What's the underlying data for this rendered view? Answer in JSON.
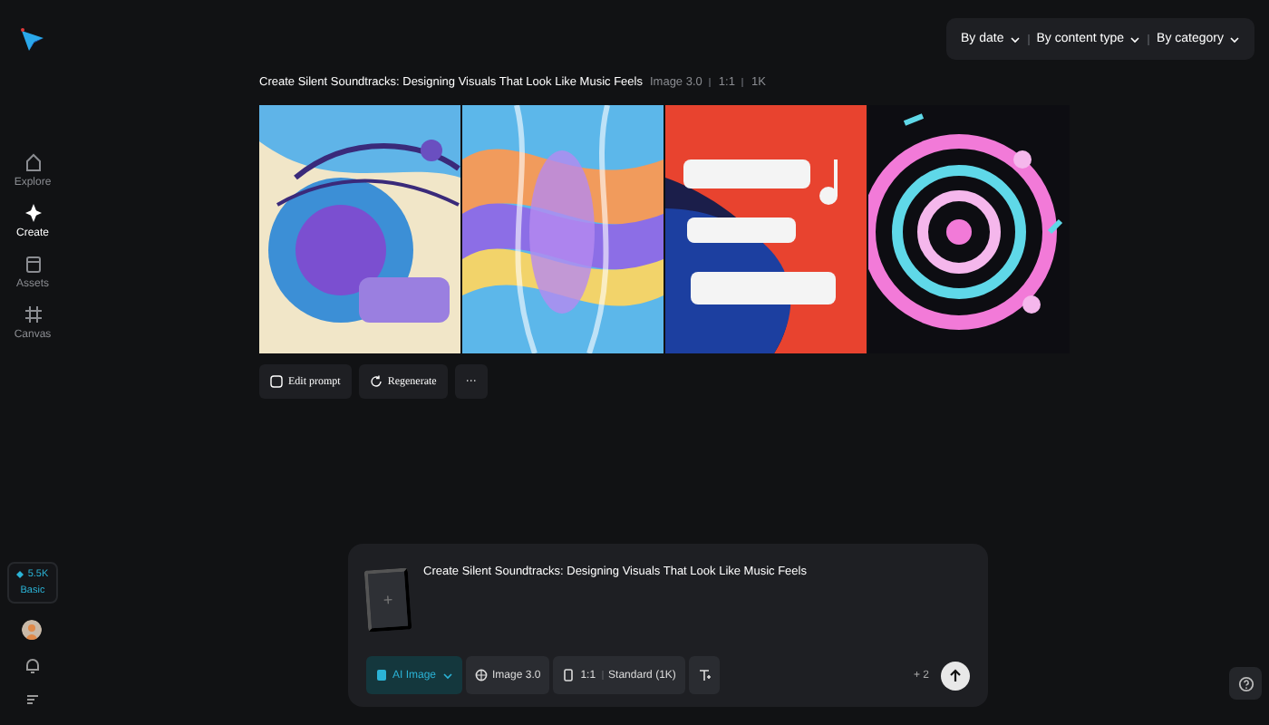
{
  "sidebar": {
    "nav": [
      {
        "label": "Explore",
        "selected": false
      },
      {
        "label": "Create",
        "selected": true
      },
      {
        "label": "Assets",
        "selected": false
      },
      {
        "label": "Canvas",
        "selected": false
      }
    ],
    "credits": {
      "amount": "5.5K",
      "plan": "Basic"
    }
  },
  "filters": [
    "By date",
    "By content type",
    "By category"
  ],
  "generation": {
    "title": "Create Silent Soundtracks: Designing Visuals That Look Like Music Feels",
    "meta": [
      "Image 3.0",
      "1:1",
      "1K"
    ],
    "images": [
      {
        "kind": "picture"
      },
      {
        "kind": "picture"
      },
      {
        "kind": "picture"
      },
      {
        "kind": "picture"
      }
    ],
    "actions": [
      {
        "kind": "edit",
        "label": "Edit prompt"
      },
      {
        "kind": "regenerate",
        "label": "Regenerate"
      },
      {
        "kind": "more",
        "label": "···"
      }
    ]
  },
  "composer": {
    "prompt": "Create Silent Soundtracks: Designing Visuals That Look Like Music Feels",
    "chips": [
      {
        "kind": "mode",
        "label": "AI Image",
        "selected": true
      },
      {
        "kind": "model",
        "label": "Image 3.0",
        "selected": false
      },
      {
        "kind": "ratio",
        "label": "1:1",
        "detail": "Standard (1K)",
        "selected": false
      },
      {
        "kind": "text",
        "selected": false
      }
    ],
    "upload": "+",
    "extra": "+ 2"
  }
}
